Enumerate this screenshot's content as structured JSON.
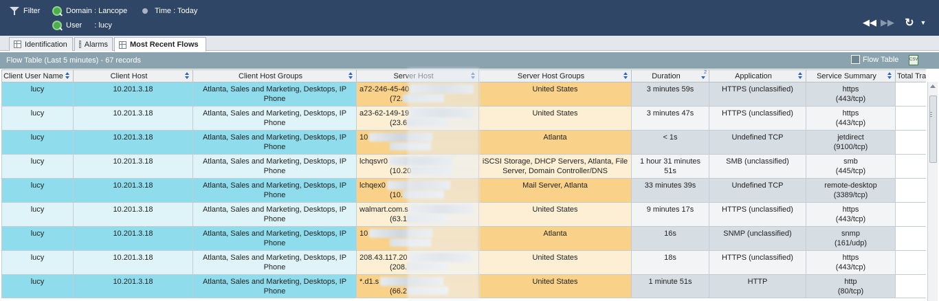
{
  "topbar": {
    "filter_label": "Filter",
    "domain_label": "Domain : Lancope",
    "time_label": "Time : Today",
    "user_label": "User",
    "user_value": ": lucy"
  },
  "tabs": [
    {
      "label": "Identification"
    },
    {
      "label": "Alarms"
    },
    {
      "label": "Most Recent Flows"
    }
  ],
  "panel": {
    "title": "Flow Table (Last 5 minutes) - 67 records",
    "flow_table_btn": "Flow Table",
    "csv_icon_text": "CSV"
  },
  "columns": [
    "Client User Name",
    "Client Host",
    "Client Host Groups",
    "Server Host",
    "Server Host Groups",
    "Duration",
    "Application",
    "Service Summary",
    "Total Tra"
  ],
  "sort_indicator": "2",
  "rows": [
    {
      "user": "lucy",
      "host": "10.201.3.18",
      "groups_l1": "Atlanta, Sales and Marketing, Desktops, IP",
      "groups_l2": "Phone",
      "server_l1": "a72-246-45-40",
      "server_l2": "(72.",
      "server_groups": "United States",
      "duration": "3 minutes 59s",
      "application": "HTTPS (unclassified)",
      "svc_l1": "https",
      "svc_l2": "(443/tcp)"
    },
    {
      "user": "lucy",
      "host": "10.201.3.18",
      "groups_l1": "Atlanta, Sales and Marketing, Desktops, IP",
      "groups_l2": "Phone",
      "server_l1": "a23-62-149-19",
      "server_l2": "(23.6",
      "server_groups": "United States",
      "duration": "3 minutes 47s",
      "application": "HTTPS (unclassified)",
      "svc_l1": "https",
      "svc_l2": "(443/tcp)"
    },
    {
      "user": "lucy",
      "host": "10.201.3.18",
      "groups_l1": "Atlanta, Sales and Marketing, Desktops, IP",
      "groups_l2": "Phone",
      "server_l1": "10",
      "server_l2": "",
      "server_groups": "Atlanta",
      "duration": "< 1s",
      "application": "Undefined TCP",
      "svc_l1": "jetdirect",
      "svc_l2": "(9100/tcp)"
    },
    {
      "user": "lucy",
      "host": "10.201.3.18",
      "groups_l1": "Atlanta, Sales and Marketing, Desktops, IP",
      "groups_l2": "Phone",
      "server_l1": "lchqsvr0",
      "server_l2": "(10.20",
      "server_groups": "iSCSI Storage, DHCP Servers, Atlanta, File Server, Domain Controller/DNS",
      "duration": "1 hour 31 minutes 51s",
      "application": "SMB (unclassified)",
      "svc_l1": "smb",
      "svc_l2": "(445/tcp)"
    },
    {
      "user": "lucy",
      "host": "10.201.3.18",
      "groups_l1": "Atlanta, Sales and Marketing, Desktops, IP",
      "groups_l2": "Phone",
      "server_l1": "lchqex0",
      "server_l2": "(10.",
      "server_groups": "Mail Server, Atlanta",
      "duration": "33 minutes 39s",
      "application": "Undefined TCP",
      "svc_l1": "remote-desktop",
      "svc_l2": "(3389/tcp)"
    },
    {
      "user": "lucy",
      "host": "10.201.3.18",
      "groups_l1": "Atlanta, Sales and Marketing, Desktops, IP",
      "groups_l2": "Phone",
      "server_l1": "walmart.com.s",
      "server_l2": "(63.1",
      "server_groups": "United States",
      "duration": "9 minutes 17s",
      "application": "HTTPS (unclassified)",
      "svc_l1": "https",
      "svc_l2": "(443/tcp)"
    },
    {
      "user": "lucy",
      "host": "10.201.3.18",
      "groups_l1": "Atlanta, Sales and Marketing, Desktops, IP",
      "groups_l2": "Phone",
      "server_l1": "10",
      "server_l2": "",
      "server_groups": "Atlanta",
      "duration": "16s",
      "application": "SNMP (unclassified)",
      "svc_l1": "snmp",
      "svc_l2": "(161/udp)"
    },
    {
      "user": "lucy",
      "host": "10.201.3.18",
      "groups_l1": "Atlanta, Sales and Marketing, Desktops, IP",
      "groups_l2": "Phone",
      "server_l1": "208.43.117.20",
      "server_l2": "(208.",
      "server_groups": "United States",
      "duration": "18s",
      "application": "HTTPS (unclassified)",
      "svc_l1": "https",
      "svc_l2": "(443/tcp)"
    },
    {
      "user": "lucy",
      "host": "10.201.3.18",
      "groups_l1": "Atlanta, Sales and Marketing, Desktops, IP",
      "groups_l2": "Phone",
      "server_l1": "*.d1.s",
      "server_l2": "(66.2",
      "server_groups": "United States",
      "duration": "1 minute 51s",
      "application": "HTTP",
      "svc_l1": "http",
      "svc_l2": "(80/tcp)"
    }
  ],
  "colors": {
    "topbar": "#2f4666",
    "panel_header": "#8aa3ae",
    "client_cyan": "#8fdcec",
    "server_orange": "#f9d188",
    "sort_arrow": "#2b62c5"
  },
  "icons": {
    "filter": "filter-icon",
    "domain": "search-icon",
    "user": "search-icon",
    "time": "dot-icon",
    "rewind": "rewind-icon",
    "forward": "fast-forward-icon",
    "refresh": "refresh-icon",
    "dropdown": "chevron-down-icon",
    "grid": "grid-icon",
    "csv": "csv-export-icon"
  }
}
